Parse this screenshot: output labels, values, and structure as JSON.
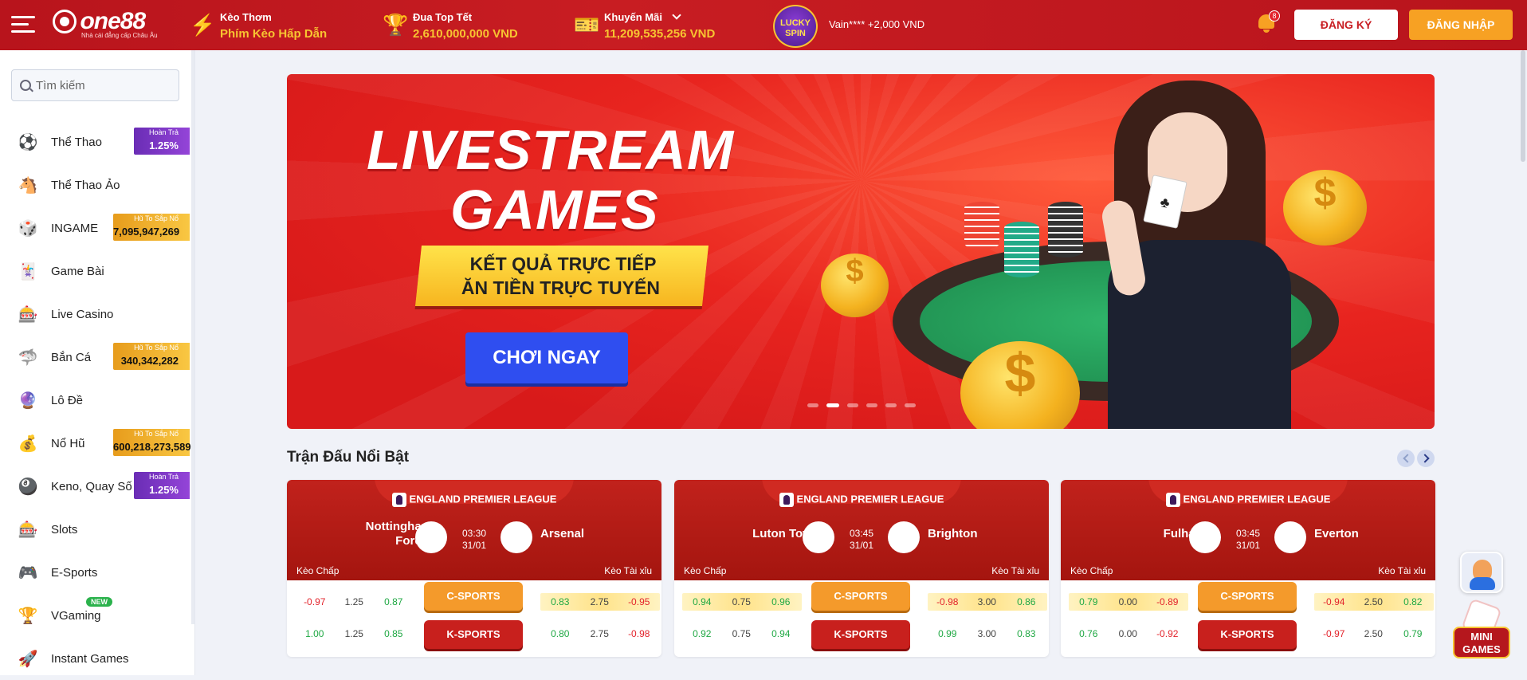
{
  "header": {
    "logo_text": "one88",
    "logo_tagline": "Nhà cái đẳng cấp Châu Âu",
    "items": [
      {
        "title": "Kèo Thơm",
        "value": "Phím Kèo Hấp Dẫn",
        "icon": "lightning-icon"
      },
      {
        "title": "Đua Top Tết",
        "value": "2,610,000,000 VND",
        "icon": "trophy-icon"
      },
      {
        "title": "Khuyến Mãi",
        "value": "11,209,535,256 VND",
        "icon": "ticket-icon"
      }
    ],
    "lucky_spin": "LUCKY SPIN",
    "winner_text": "Vain**** +2,000 VND",
    "notification_count": "8",
    "register_label": "ĐĂNG KÝ",
    "login_label": "ĐĂNG NHẬP"
  },
  "sidebar": {
    "search_placeholder": "Tìm kiếm",
    "items": [
      {
        "label": "Thể Thao",
        "badge": {
          "type": "purple",
          "line1": "Hoàn Trả",
          "line2": "1.25%"
        }
      },
      {
        "label": "Thể Thao Ảo"
      },
      {
        "label": "INGAME",
        "badge": {
          "type": "gold",
          "line1": "Hũ To Sắp Nổ",
          "line2": "7,095,947,269"
        }
      },
      {
        "label": "Game Bài"
      },
      {
        "label": "Live Casino"
      },
      {
        "label": "Bắn Cá",
        "badge": {
          "type": "gold",
          "line1": "Hũ To Sắp Nổ",
          "line2": "340,342,282"
        }
      },
      {
        "label": "Lô Đề"
      },
      {
        "label": "Nổ Hũ",
        "badge": {
          "type": "gold",
          "line1": "Hũ To Sắp Nổ",
          "line2": "600,218,273,589"
        }
      },
      {
        "label": "Keno, Quay Số",
        "badge": {
          "type": "purple",
          "line1": "Hoàn Trả",
          "line2": "1.25%"
        }
      },
      {
        "label": "Slots"
      },
      {
        "label": "E-Sports"
      },
      {
        "label": "VGaming",
        "new": "NEW"
      },
      {
        "label": "Instant Games"
      }
    ]
  },
  "banner": {
    "title_line1": "LIVESTREAM",
    "title_line2": "GAMES",
    "ribbon_line1": "KẾT QUẢ TRỰC TIẾP",
    "ribbon_line2": "ĂN TIỀN TRỰC TUYẾN",
    "cta": "CHƠI NGAY",
    "slide_count": 6,
    "active_slide": 2
  },
  "featured": {
    "title": "Trận Đấu Nổi Bật",
    "handicap_label": "Kèo Chấp",
    "ou_label": "Kèo Tài xỉu",
    "csports": "C-SPORTS",
    "ksports": "K-SPORTS",
    "matches": [
      {
        "league": "ENGLAND PREMIER LEAGUE",
        "home": "Nottingham Forest",
        "away": "Arsenal",
        "time": "03:30",
        "date": "31/01",
        "c_hdp": [
          "-0.97",
          "1.25",
          "0.87"
        ],
        "c_ou": [
          "0.83",
          "2.75",
          "-0.95"
        ],
        "k_hdp": [
          "1.00",
          "1.25",
          "0.85"
        ],
        "k_ou": [
          "0.80",
          "2.75",
          "-0.98"
        ]
      },
      {
        "league": "ENGLAND PREMIER LEAGUE",
        "home": "Luton Town",
        "away": "Brighton",
        "time": "03:45",
        "date": "31/01",
        "c_hdp": [
          "0.94",
          "0.75",
          "0.96"
        ],
        "c_ou": [
          "-0.98",
          "3.00",
          "0.86"
        ],
        "k_hdp": [
          "0.92",
          "0.75",
          "0.94"
        ],
        "k_ou": [
          "0.99",
          "3.00",
          "0.83"
        ]
      },
      {
        "league": "ENGLAND PREMIER LEAGUE",
        "home": "Fulham",
        "away": "Everton",
        "time": "03:45",
        "date": "31/01",
        "c_hdp": [
          "0.79",
          "0.00",
          "-0.89"
        ],
        "c_ou": [
          "-0.94",
          "2.50",
          "0.82"
        ],
        "k_hdp": [
          "0.76",
          "0.00",
          "-0.92"
        ],
        "k_ou": [
          "-0.97",
          "2.50",
          "0.79"
        ]
      }
    ]
  },
  "floating": {
    "mini_games": "MINI GAMES"
  },
  "colors": {
    "brand_red": "#c81d22",
    "gold": "#f7c431",
    "cta_blue": "#2f4ef0"
  }
}
